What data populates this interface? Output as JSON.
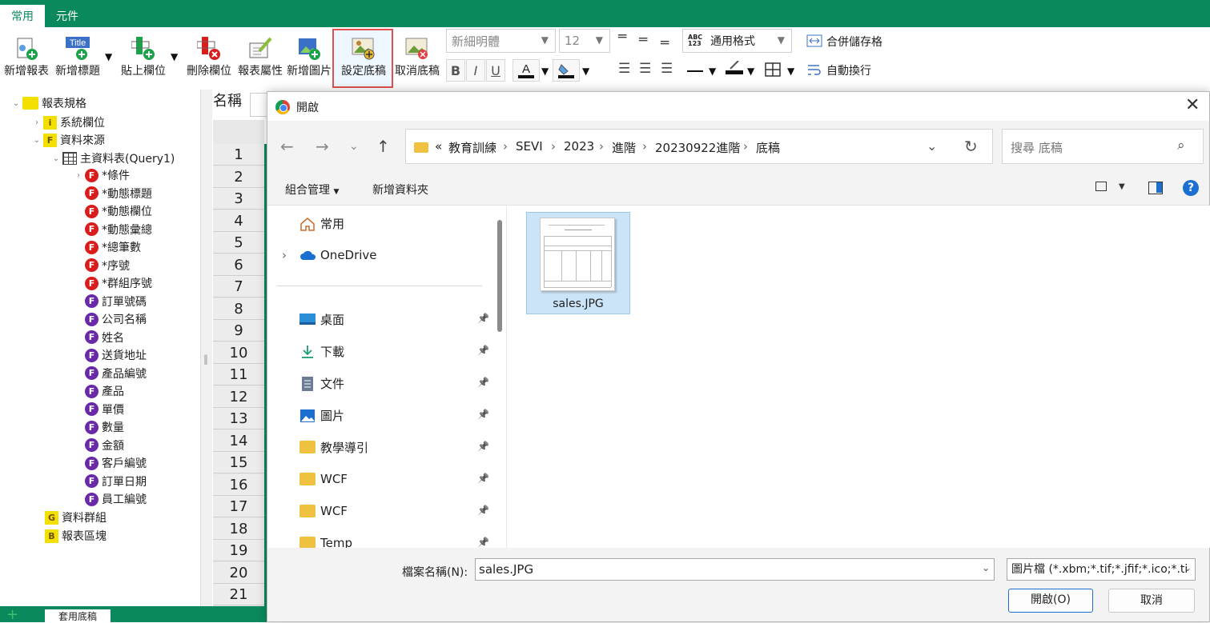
{
  "tabs": {
    "common": "常用",
    "components": "元件"
  },
  "ribbon": {
    "new_report": "新增報表",
    "new_title": "新增標題",
    "title_icon_text": "Title",
    "paste_field": "貼上欄位",
    "delete_field": "刪除欄位",
    "report_props": "報表屬性",
    "new_image": "新增圖片",
    "set_background": "設定底稿",
    "cancel_background": "取消底稿",
    "font_name": "新細明體",
    "font_size": "12",
    "bold": "B",
    "italic": "I",
    "underline": "U",
    "number_format_icon": "ABC 123",
    "number_format": "通用格式",
    "merge_cells": "合併儲存格",
    "wrap_text": "自動換行",
    "accent_color": "#0a8a5c",
    "highlight_color": "#e05050"
  },
  "tree": {
    "root": "報表規格",
    "system_fields": "系統欄位",
    "data_source": "資料來源",
    "main_table": "主資料表(Query1)",
    "items": [
      {
        "label": "*條件",
        "kind": "red",
        "expandable": true
      },
      {
        "label": "*動態標題",
        "kind": "red"
      },
      {
        "label": "*動態欄位",
        "kind": "red"
      },
      {
        "label": "*動態彙總",
        "kind": "red"
      },
      {
        "label": "*總筆數",
        "kind": "red"
      },
      {
        "label": "*序號",
        "kind": "red"
      },
      {
        "label": "*群組序號",
        "kind": "red"
      },
      {
        "label": "訂單號碼",
        "kind": "purple"
      },
      {
        "label": "公司名稱",
        "kind": "purple"
      },
      {
        "label": "姓名",
        "kind": "purple"
      },
      {
        "label": "送貨地址",
        "kind": "purple"
      },
      {
        "label": "產品編號",
        "kind": "purple"
      },
      {
        "label": "產品",
        "kind": "purple"
      },
      {
        "label": "單價",
        "kind": "purple"
      },
      {
        "label": "數量",
        "kind": "purple"
      },
      {
        "label": "金額",
        "kind": "purple"
      },
      {
        "label": "客戶編號",
        "kind": "purple"
      },
      {
        "label": "訂單日期",
        "kind": "purple"
      },
      {
        "label": "員工編號",
        "kind": "purple"
      }
    ],
    "data_group": "資料群組",
    "report_region": "報表區塊",
    "badge_f": "F",
    "badge_i": "i",
    "badge_g": "G",
    "badge_b": "B"
  },
  "grid": {
    "name_header": "名稱",
    "rows": [
      "1",
      "2",
      "3",
      "4",
      "5",
      "6",
      "7",
      "8",
      "9",
      "10",
      "11",
      "12",
      "13",
      "14",
      "15",
      "16",
      "17",
      "18",
      "19",
      "20",
      "21"
    ]
  },
  "bottom_tab": "套用底稿",
  "dialog": {
    "title": "開啟",
    "breadcrumb": [
      "«",
      "教育訓練",
      "SEVI",
      "2023",
      "進階",
      "20230922進階",
      "底稿"
    ],
    "search_placeholder": "搜尋 底稿",
    "organize": "組合管理",
    "new_folder": "新增資料夾",
    "help": "?",
    "nav_items": [
      {
        "label": "常用",
        "icon": "home-icon"
      },
      {
        "label": "OneDrive",
        "icon": "cloud-icon"
      },
      {
        "label": "桌面",
        "icon": "desktop-icon",
        "pinned": true
      },
      {
        "label": "下載",
        "icon": "download-icon",
        "pinned": true
      },
      {
        "label": "文件",
        "icon": "document-icon",
        "pinned": true
      },
      {
        "label": "圖片",
        "icon": "picture-icon",
        "pinned": true
      },
      {
        "label": "教學導引",
        "icon": "folder-icon",
        "pinned": true
      },
      {
        "label": "WCF",
        "icon": "folder-icon",
        "pinned": true
      },
      {
        "label": "WCF",
        "icon": "folder-icon",
        "pinned": true
      },
      {
        "label": "Temp",
        "icon": "folder-icon",
        "pinned": true
      }
    ],
    "files": [
      {
        "name": "sales.JPG",
        "selected": true
      }
    ],
    "filename_label": "檔案名稱(N):",
    "filename_value": "sales.JPG",
    "filetype": "圖片檔 (*.xbm;*.tif;*.jfif;*.ico;*.ti",
    "open_button": "開啟(O)",
    "cancel_button": "取消"
  }
}
